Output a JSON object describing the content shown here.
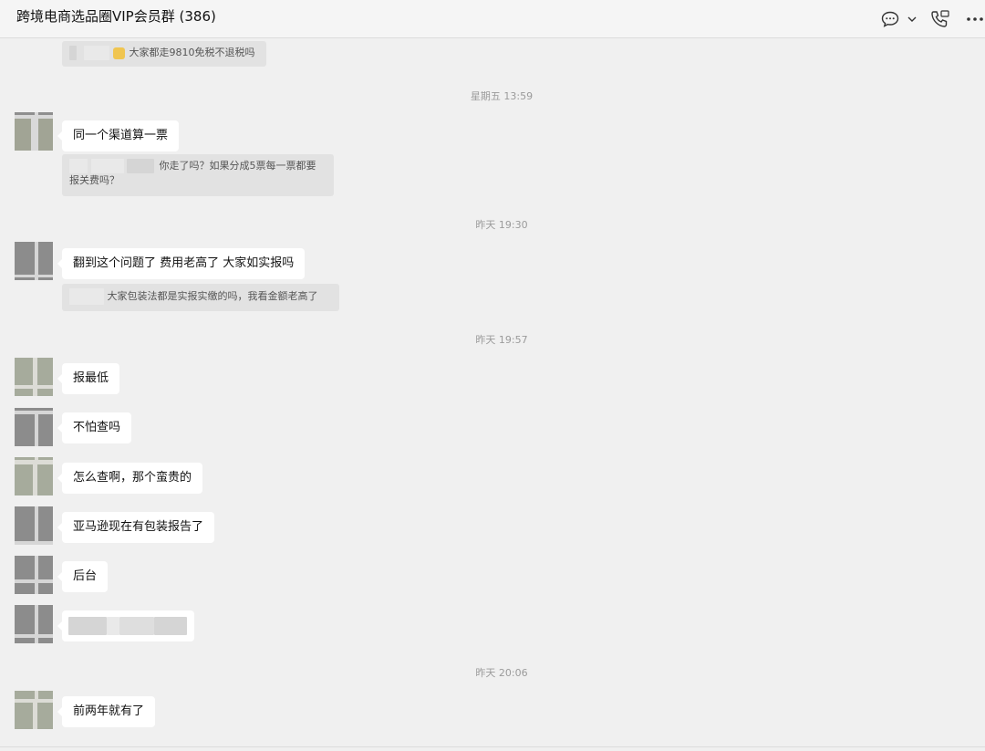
{
  "header": {
    "title": "跨境电商选品圈VIP会员群 (386)",
    "icons": [
      "chat-bubble-icon",
      "chevron-down-icon",
      "phone-icon",
      "more-icon"
    ]
  },
  "messages": [
    {
      "type": "quote",
      "text": "大家都走9810免税不退税吗"
    },
    {
      "type": "timestamp",
      "text": "星期五 13:59"
    },
    {
      "type": "text",
      "text": "同一个渠道算一票"
    },
    {
      "type": "quote",
      "line1": "你走了吗？如果分成5票每一票都要",
      "line2": "报关费吗？"
    },
    {
      "type": "timestamp",
      "text": "昨天 19:30"
    },
    {
      "type": "text",
      "text": "翻到这个问题了  费用老高了  大家如实报吗"
    },
    {
      "type": "quote",
      "text": "大家包装法都是实报实缴的吗，我看金额老高了"
    },
    {
      "type": "timestamp",
      "text": "昨天 19:57"
    },
    {
      "type": "text",
      "text": "报最低"
    },
    {
      "type": "text",
      "text": "不怕查吗"
    },
    {
      "type": "text",
      "text": "怎么查啊，那个蛮贵的"
    },
    {
      "type": "text",
      "text": "亚马逊现在有包装报告了"
    },
    {
      "type": "text",
      "text": "后台"
    },
    {
      "type": "blurred"
    },
    {
      "type": "timestamp",
      "text": "昨天 20:06"
    },
    {
      "type": "text",
      "text": "前两年就有了"
    }
  ]
}
